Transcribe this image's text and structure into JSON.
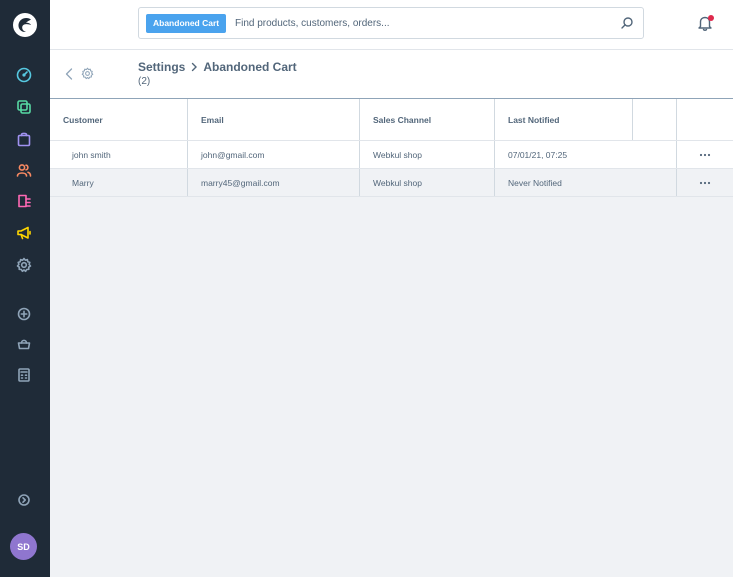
{
  "search": {
    "tag_label": "Abandoned Cart",
    "placeholder": "Find products, customers, orders..."
  },
  "header": {
    "breadcrumb_parent": "Settings",
    "breadcrumb_current": "Abandoned Cart",
    "count": "(2)"
  },
  "user": {
    "initials": "SD"
  },
  "colors": {
    "sidebar": "#1f2b38",
    "accent_blue": "#4aa3ee",
    "avatar": "#8f76cf",
    "notification_dot": "#de294c"
  },
  "sidebar": {
    "items": [
      {
        "icon": "dashboard-icon",
        "color": "#56c8e0"
      },
      {
        "icon": "catalogue-icon",
        "color": "#57d9a3"
      },
      {
        "icon": "orders-icon",
        "color": "#a092f0"
      },
      {
        "icon": "customers-icon",
        "color": "#f88962"
      },
      {
        "icon": "content-icon",
        "color": "#ff68b4"
      },
      {
        "icon": "marketing-icon",
        "color": "#ffd700"
      },
      {
        "icon": "settings-icon",
        "color": "#8fa4b8"
      },
      {
        "icon": "add-circle-icon",
        "color": "#8fa4b8"
      },
      {
        "icon": "basket-icon",
        "color": "#8fa4b8"
      },
      {
        "icon": "calculator-icon",
        "color": "#8fa4b8"
      },
      {
        "icon": "collapse-sidebar-icon",
        "color": "#8fa4b8"
      }
    ]
  },
  "grid": {
    "columns": [
      "Customer",
      "Email",
      "Sales Channel",
      "Last Notified"
    ],
    "rows": [
      {
        "customer": "john smith",
        "email": "john@gmail.com",
        "sales_channel": "Webkul shop",
        "last_notified": "07/01/21, 07:25"
      },
      {
        "customer": "Marry",
        "email": "marry45@gmail.com",
        "sales_channel": "Webkul shop",
        "last_notified": "Never Notified"
      }
    ]
  }
}
